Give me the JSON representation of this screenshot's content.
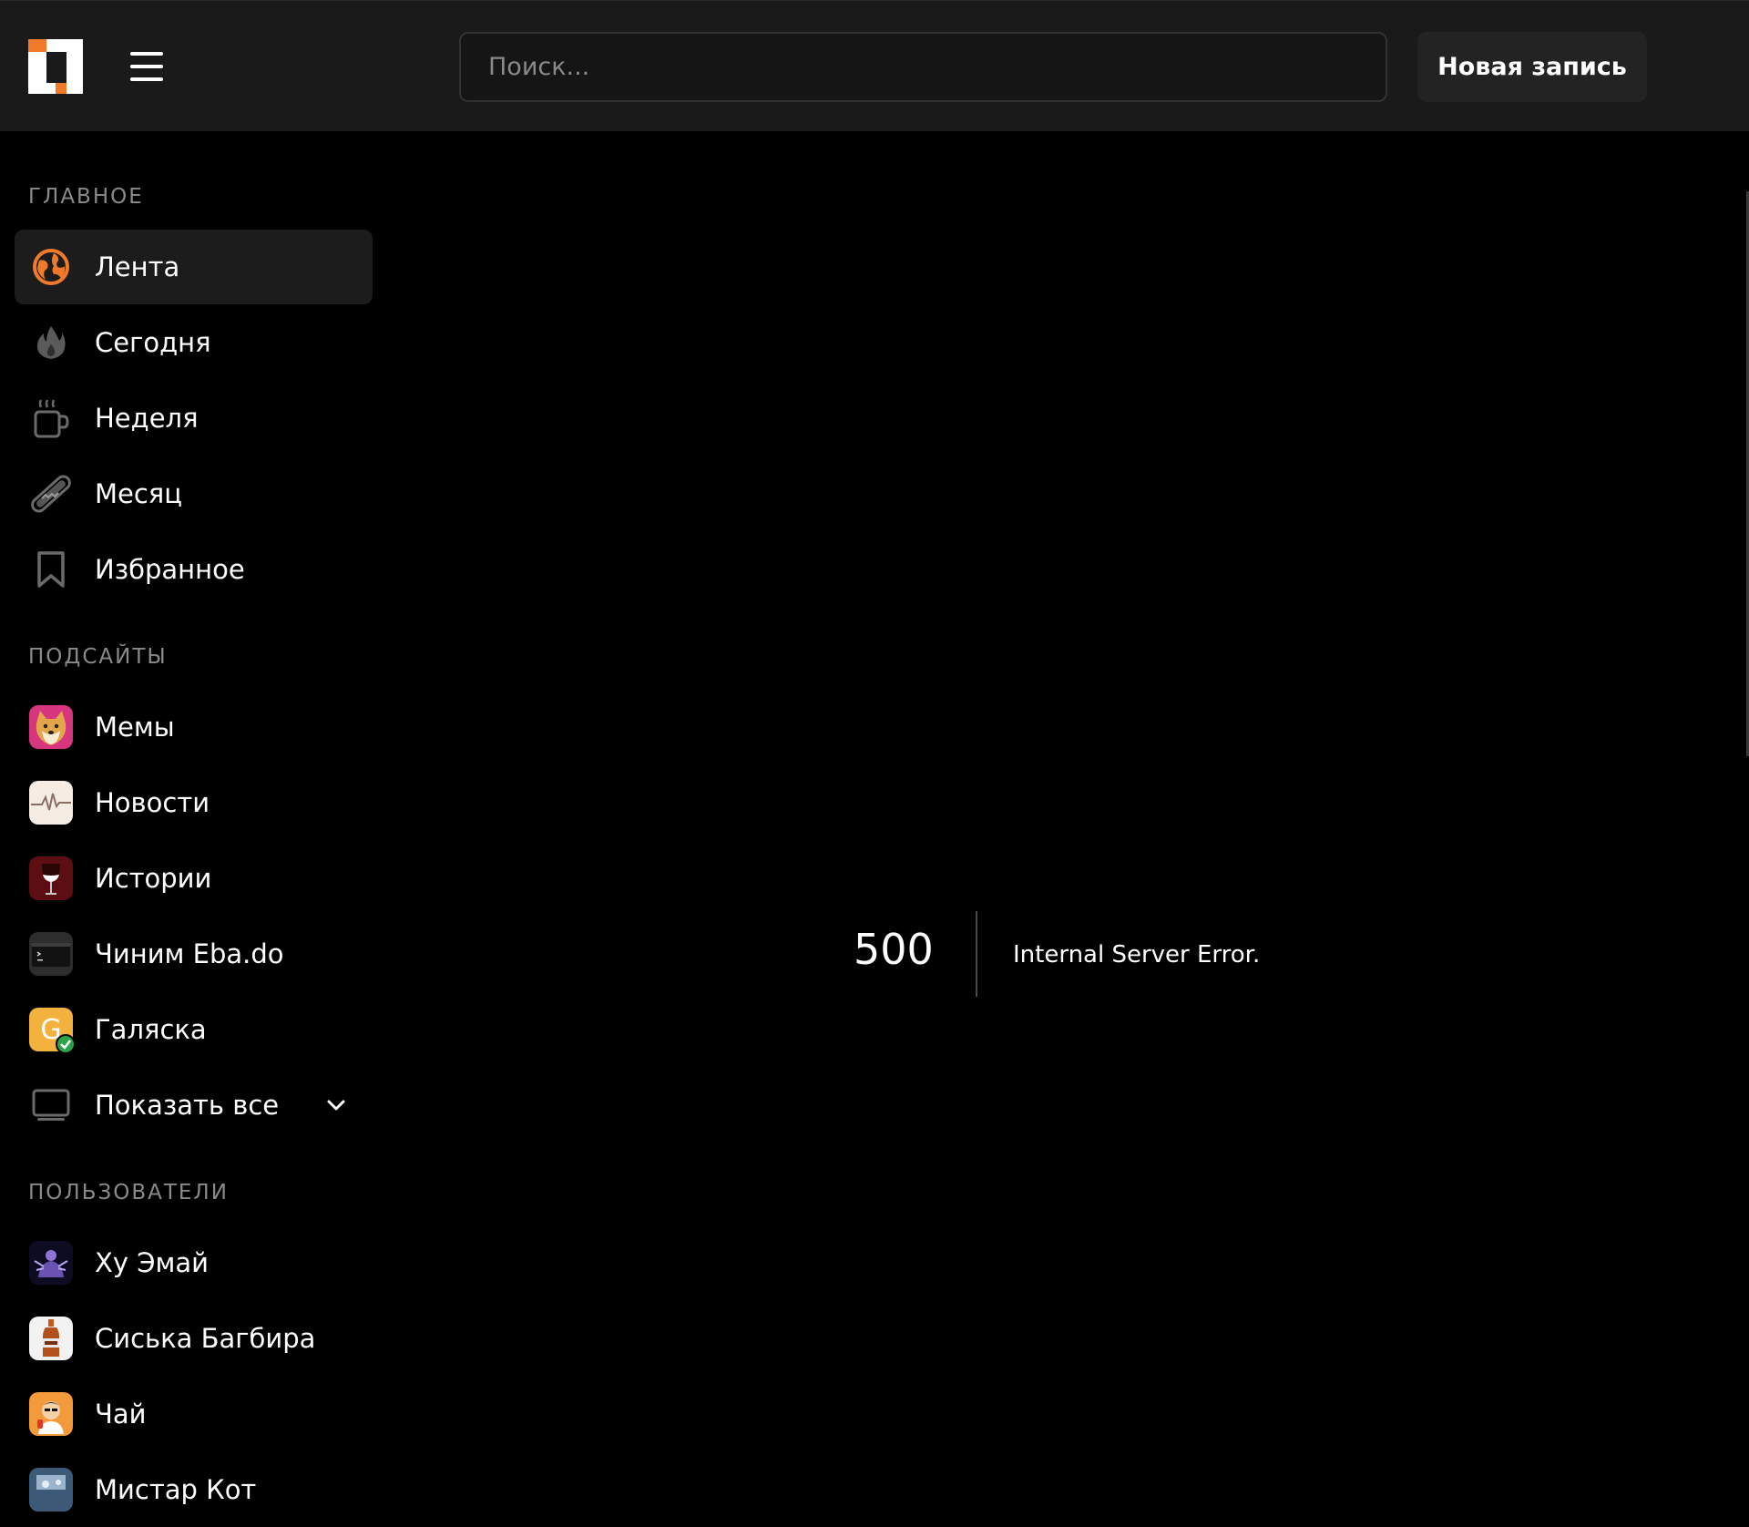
{
  "header": {
    "search_placeholder": "Поиск...",
    "new_post_label": "Новая запись"
  },
  "sidebar": {
    "main_title": "Главное",
    "main_items": [
      {
        "label": "Лента",
        "icon": "globe-icon",
        "active": true
      },
      {
        "label": "Сегодня",
        "icon": "flame-icon"
      },
      {
        "label": "Неделя",
        "icon": "mug-icon"
      },
      {
        "label": "Месяц",
        "icon": "hotdog-icon"
      },
      {
        "label": "Избранное",
        "icon": "bookmark-icon"
      }
    ],
    "subsites_title": "Подсайты",
    "subsites": [
      {
        "label": "Мемы",
        "icon": "doge-avatar-icon"
      },
      {
        "label": "Новости",
        "icon": "pulse-avatar-icon"
      },
      {
        "label": "Истории",
        "icon": "wine-glass-avatar-icon"
      },
      {
        "label": "Чиним Eba.do",
        "icon": "terminal-avatar-icon"
      },
      {
        "label": "Галяска",
        "icon": "g-verified-avatar-icon"
      }
    ],
    "show_all_label": "Показать все",
    "users_title": "Пользователи",
    "users": [
      {
        "label": "Ху Эмай",
        "icon": "user-avatar-icon"
      },
      {
        "label": "Сиська Багбира",
        "icon": "bottle-avatar-icon"
      },
      {
        "label": "Чай",
        "icon": "person-avatar-icon"
      },
      {
        "label": "Мистар Кот",
        "icon": "cat-avatar-icon"
      }
    ]
  },
  "error": {
    "code": "500",
    "message": "Internal Server Error."
  },
  "colors": {
    "accent": "#f07a2a",
    "header_bg": "#1a1a1a",
    "active_item_bg": "#1c1c1c",
    "section_title": "#8a8a8a"
  }
}
